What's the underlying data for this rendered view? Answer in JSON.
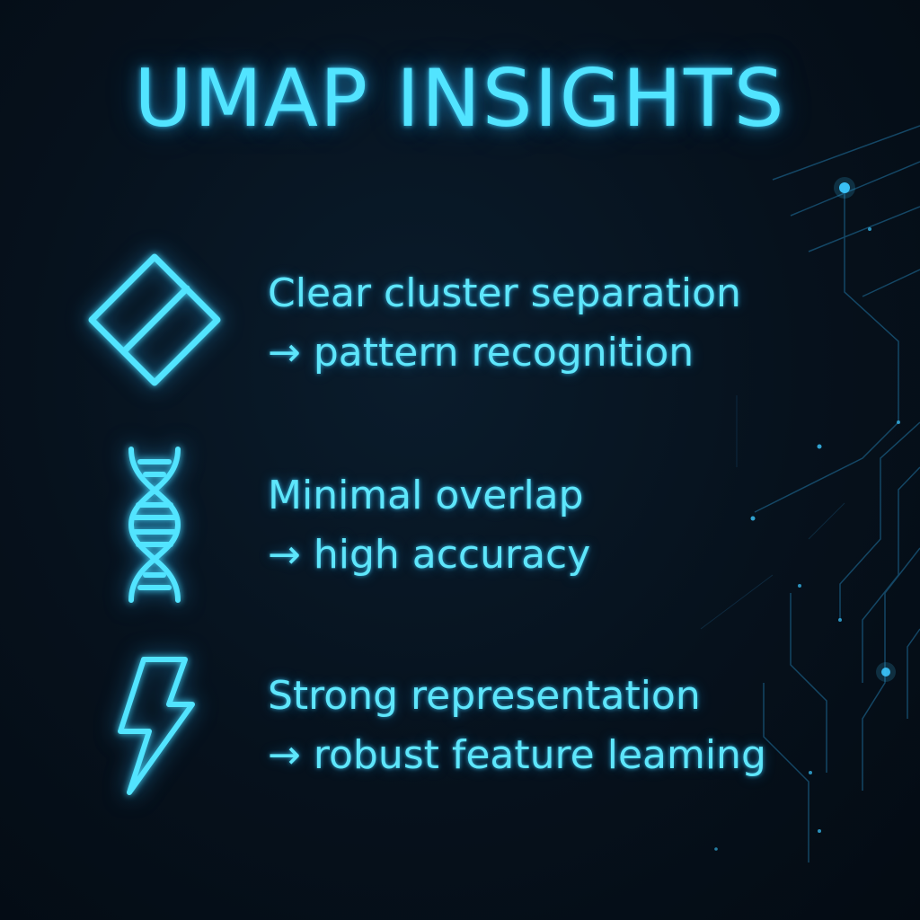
{
  "title": "UMAP INSIGHTS",
  "insights": [
    {
      "icon": "cluster-diamond-icon",
      "line1": "Clear cluster separation",
      "line2": "→ pattern recognition"
    },
    {
      "icon": "dna-helix-icon",
      "line1": "Minimal overlap",
      "line2": "→ high accuracy"
    },
    {
      "icon": "lightning-bolt-icon",
      "line1": "Strong representation",
      "line2": "→ robust feature leaming"
    }
  ],
  "colors": {
    "background": "#06111c",
    "accent": "#52e4ff",
    "text": "#5ee6fb",
    "circuit": "#1b5f86"
  }
}
